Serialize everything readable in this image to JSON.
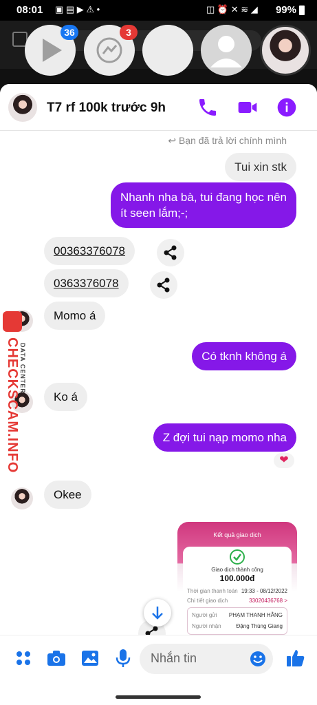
{
  "status_bar": {
    "time": "08:01",
    "battery": "99%"
  },
  "chat_heads": [
    {
      "name": "video-app",
      "badge": "36",
      "badge_color": "#1877f2"
    },
    {
      "name": "messenger",
      "badge": "3",
      "badge_color": "#e53935"
    },
    {
      "name": "blank-contact",
      "badge": ""
    },
    {
      "name": "default-contact",
      "badge": ""
    },
    {
      "name": "selected-contact",
      "badge": ""
    }
  ],
  "header": {
    "title": "T7 rf 100k trước 9h"
  },
  "reply_note": "Bạn đã trả lời chính mình",
  "messages": {
    "m1": "Tui xin stk",
    "m2_line1": "Nhanh nha bà, tui đang học nên",
    "m2_line2": "ít seen lắm;-;",
    "m3": "00363376078",
    "m4": "0363376078",
    "m5": "Momo á",
    "m6": "Có tknh không á",
    "m7": "Ko á",
    "m8": "Z đợi tui nạp momo nha",
    "m9": "Okee"
  },
  "receipt": {
    "title": "Kết quả giao dịch",
    "status": "Giao dịch thành công",
    "amount": "100.000đ",
    "time_label": "Thời gian thanh toán",
    "time_value": "19:33 - 08/12/2022",
    "detail_label": "Chi tiết giao dịch",
    "detail_value": "33020436768 >",
    "sender_label": "Người gửi",
    "sender_value": "PHẠM THANH HẰNG",
    "receiver_label": "Người nhận",
    "receiver_value": "Đặng Thùng Giang"
  },
  "composer": {
    "placeholder": "Nhắn tin"
  },
  "watermark": {
    "brand": "CHECKSCAM.INFO",
    "sub": "DATA CENTER"
  },
  "colors": {
    "accent": "#8518e8",
    "header_icons": "#8a1cff",
    "composer_icons": "#1a73e8"
  }
}
